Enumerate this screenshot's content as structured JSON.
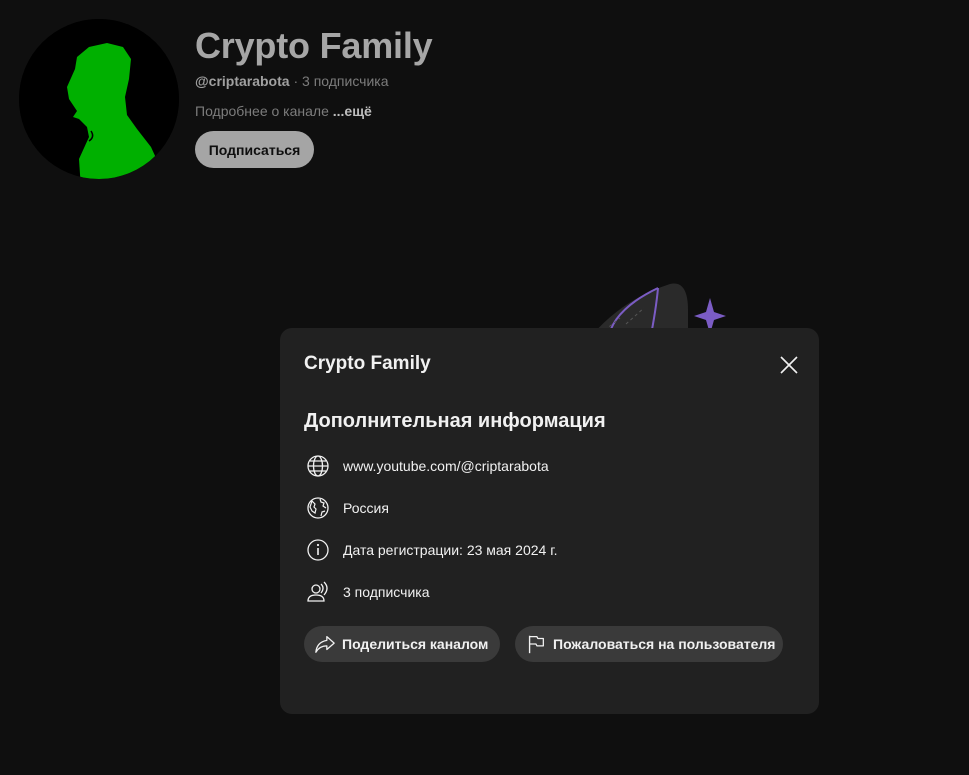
{
  "channel": {
    "title": "Crypto Family",
    "handle": "@criptarabota",
    "separator": " · ",
    "subscribers": "3 подписчика",
    "description": "Подробнее о канале ",
    "more_label": "...ещё",
    "subscribe_label": "Подписаться",
    "avatar_icon": "person-silhouette-icon",
    "avatar_color": "#00b000"
  },
  "dialog": {
    "title": "Crypto Family",
    "close_icon": "close-icon",
    "section_title": "Дополнительная информация",
    "rows": [
      {
        "icon": "globe-icon",
        "text": "www.youtube.com/@criptarabota"
      },
      {
        "icon": "country-globe-icon",
        "text": "Россия"
      },
      {
        "icon": "info-icon",
        "text": "Дата регистрации: 23 мая 2024 г."
      },
      {
        "icon": "subscribers-icon",
        "text": "3 подписчика"
      }
    ],
    "actions": {
      "share_label": "Поделиться каналом",
      "share_icon": "share-arrow-icon",
      "report_label": "Пожаловаться на пользователя",
      "report_icon": "flag-icon"
    }
  },
  "colors": {
    "background": "#0f0f0f",
    "dialog_bg": "#212121",
    "button_bg": "#3a3a3a",
    "accent_purple": "#7b5cc4"
  }
}
